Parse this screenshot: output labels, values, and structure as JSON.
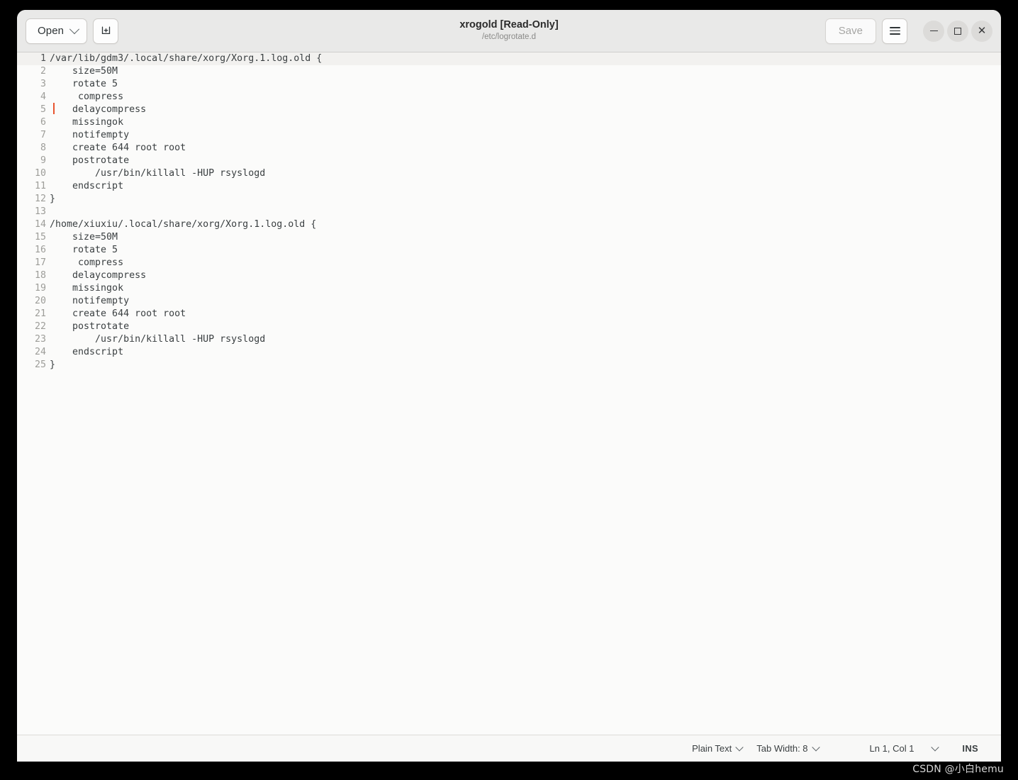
{
  "window": {
    "title": "xrogold [Read-Only]",
    "subtitle": "/etc/logrotate.d"
  },
  "headerbar": {
    "open_label": "Open",
    "save_label": "Save",
    "new_tab_icon": "new-document-icon",
    "menu_icon": "hamburger-menu-icon",
    "minimize_icon": "minimize-icon",
    "maximize_icon": "maximize-icon",
    "close_icon": "close-icon"
  },
  "editor": {
    "lines": [
      {
        "n": "1",
        "text": "/var/lib/gdm3/.local/share/xorg/Xorg.1.log.old {"
      },
      {
        "n": "2",
        "text": "    size=50M"
      },
      {
        "n": "3",
        "text": "    rotate 5"
      },
      {
        "n": "4",
        "text": "     compress"
      },
      {
        "n": "5",
        "text": "    delaycompress"
      },
      {
        "n": "6",
        "text": "    missingok"
      },
      {
        "n": "7",
        "text": "    notifempty"
      },
      {
        "n": "8",
        "text": "    create 644 root root"
      },
      {
        "n": "9",
        "text": "    postrotate"
      },
      {
        "n": "10",
        "text": "        /usr/bin/killall -HUP rsyslogd"
      },
      {
        "n": "11",
        "text": "    endscript"
      },
      {
        "n": "12",
        "text": "}"
      },
      {
        "n": "13",
        "text": ""
      },
      {
        "n": "14",
        "text": "/home/xiuxiu/.local/share/xorg/Xorg.1.log.old {"
      },
      {
        "n": "15",
        "text": "    size=50M"
      },
      {
        "n": "16",
        "text": "    rotate 5"
      },
      {
        "n": "17",
        "text": "     compress"
      },
      {
        "n": "18",
        "text": "    delaycompress"
      },
      {
        "n": "19",
        "text": "    missingok"
      },
      {
        "n": "20",
        "text": "    notifempty"
      },
      {
        "n": "21",
        "text": "    create 644 root root"
      },
      {
        "n": "22",
        "text": "    postrotate"
      },
      {
        "n": "23",
        "text": "        /usr/bin/killall -HUP rsyslogd"
      },
      {
        "n": "24",
        "text": "    endscript"
      },
      {
        "n": "25",
        "text": "}"
      }
    ],
    "current_line_index": 0,
    "cursor_color": "#e8542f"
  },
  "statusbar": {
    "language": "Plain Text",
    "tab_width": "Tab Width: 8",
    "position": "Ln 1, Col 1",
    "insert_mode": "INS"
  },
  "watermark": "CSDN @小白hemu",
  "colors": {
    "headerbar_bg": "#e9e9e8",
    "editor_bg": "#fbfbfa",
    "current_line_bg": "#f2f1ef",
    "text": "#3a3f41",
    "line_number": "#9d9d99",
    "statusbar_bg": "#f8f8f7"
  }
}
